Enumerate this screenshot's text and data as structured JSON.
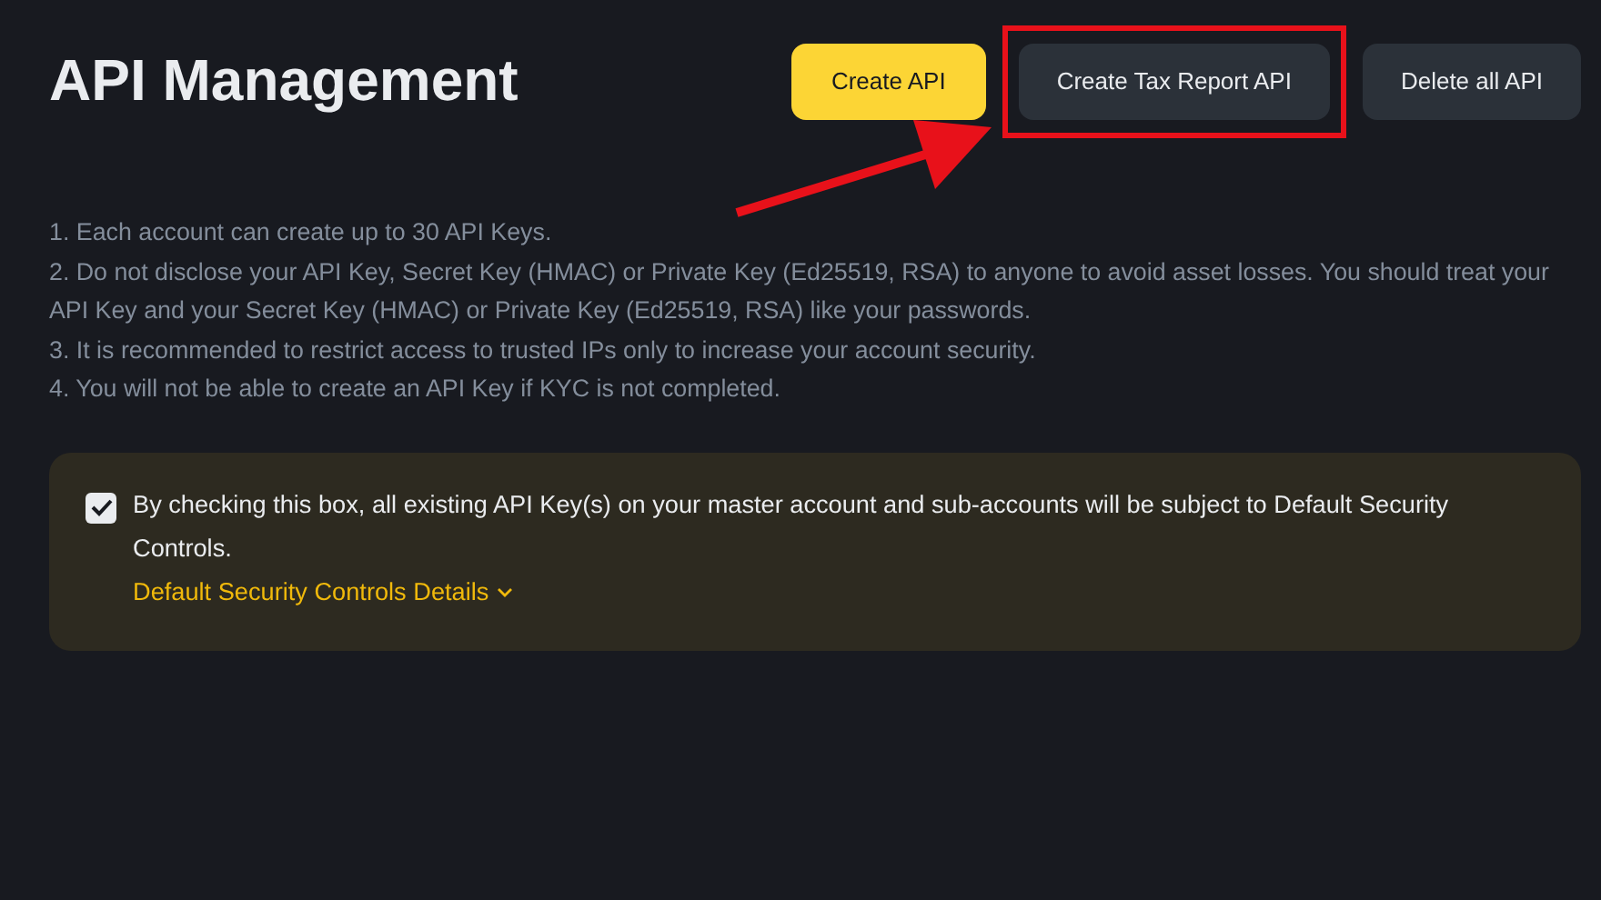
{
  "title": "API Management",
  "buttons": [
    {
      "label": "Create API",
      "kind": "primary",
      "highlighted": false
    },
    {
      "label": "Create Tax Report API",
      "kind": "secondary",
      "highlighted": true
    },
    {
      "label": "Delete all API",
      "kind": "secondary",
      "highlighted": false
    }
  ],
  "notes": [
    "1. Each account can create up to 30 API Keys.",
    "2. Do not disclose your API Key, Secret Key (HMAC) or Private Key (Ed25519, RSA) to anyone to avoid asset losses. You should treat your API Key and your Secret Key (HMAC) or Private Key (Ed25519, RSA) like your passwords.",
    "3. It is recommended to restrict access to trusted IPs only to increase your account security.",
    "4. You will not be able to create an API Key if KYC is not completed."
  ],
  "consent": {
    "checked": true,
    "text": "By checking this box, all existing API Key(s) on your master account and sub-accounts will be subject to Default Security Controls.",
    "link": "Default Security Controls Details"
  }
}
